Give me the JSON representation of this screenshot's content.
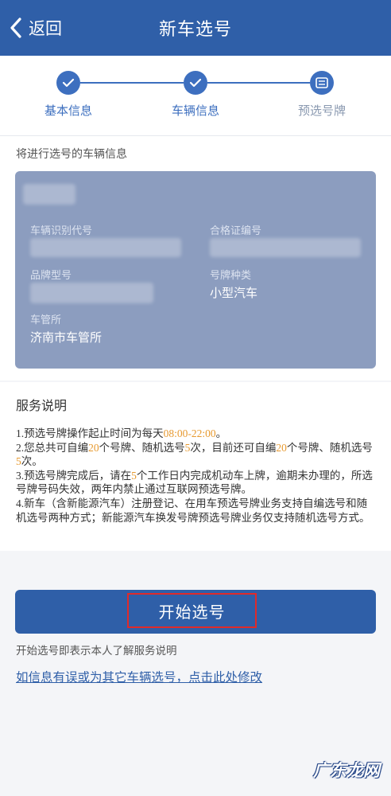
{
  "header": {
    "back_label": "返回",
    "title": "新车选号"
  },
  "steps": [
    {
      "label": "基本信息",
      "state": "done"
    },
    {
      "label": "车辆信息",
      "state": "done"
    },
    {
      "label": "预选号牌",
      "state": "current"
    }
  ],
  "vehicle_info": {
    "heading": "将进行选号的车辆信息",
    "fields": {
      "vin_label": "车辆识别代号",
      "cert_label": "合格证编号",
      "model_label": "品牌型号",
      "plate_type_label": "号牌种类",
      "plate_type_value": "小型汽车",
      "office_label": "车管所",
      "office_value": "济南市车管所"
    }
  },
  "service": {
    "title": "服务说明",
    "item1_a": "1.预选号牌操作起止时间为每天",
    "item1_time": "08:00-22:00",
    "item1_b": "。",
    "item2_a": "2.您总共可自编",
    "item2_n1": "20",
    "item2_b": "个号牌、随机选号",
    "item2_n2": "5",
    "item2_c": "次，目前还可自编",
    "item2_n3": "20",
    "item2_d": "个号牌、随机选号",
    "item2_n4": "5",
    "item2_e": "次。",
    "item3_a": "3.预选号牌完成后，请在",
    "item3_n": "5",
    "item3_b": "个工作日内完成机动车上牌，逾期未办理的，所选号牌号码失效，两年内禁止通过互联网预选号牌。",
    "item4": "4.新车（含新能源汽车）注册登记、在用车预选号牌业务支持自编选号和随机选号两种方式；新能源汽车换发号牌预选号牌业务仅支持随机选号方式。"
  },
  "actions": {
    "start_label": "开始选号",
    "start_note": "开始选号即表示本人了解服务说明",
    "modify_link": "如信息有误或为其它车辆选号，点击此处修改"
  },
  "watermark": "广东龙网",
  "colors": {
    "primary": "#2f5fa8",
    "step": "#3d6fbf",
    "card": "#8c9dbf",
    "highlight": "#e79a30",
    "annotation_red": "#e02a2a"
  }
}
